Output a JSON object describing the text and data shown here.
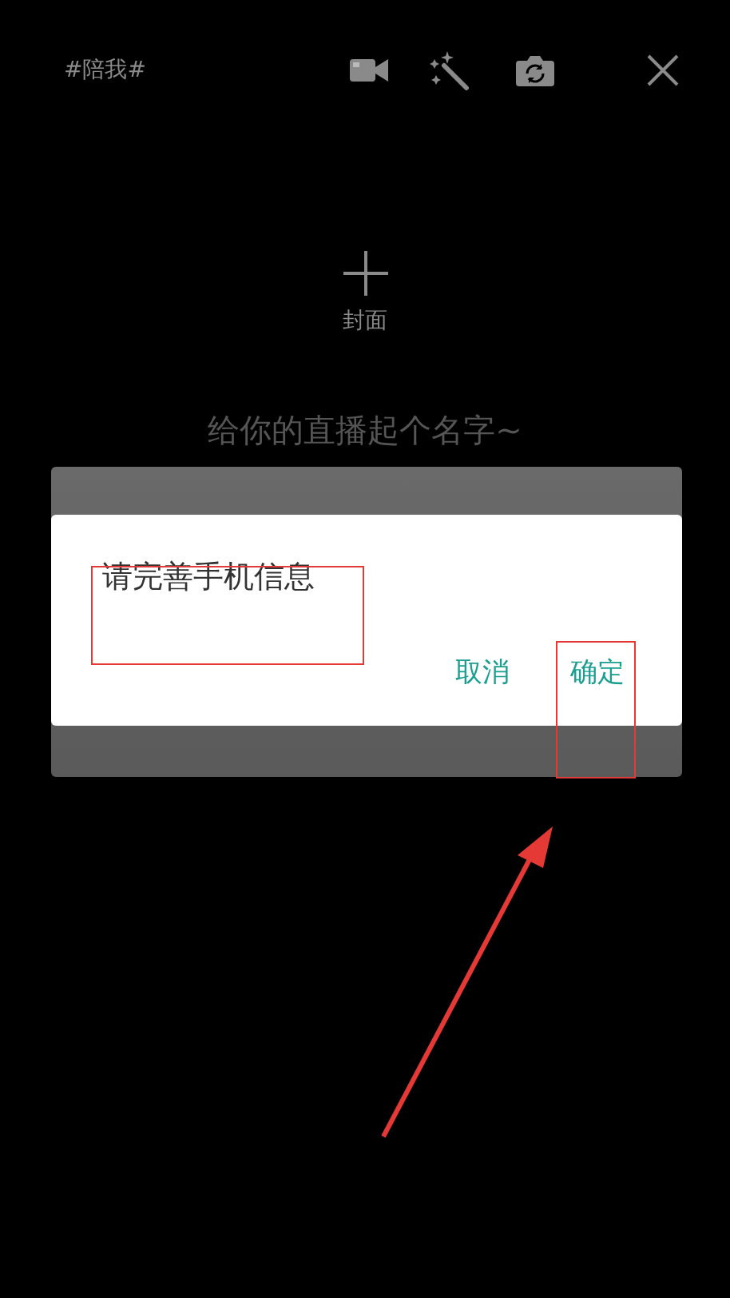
{
  "top_bar": {
    "topic": "#陪我#"
  },
  "cover": {
    "label": "封面"
  },
  "title_field": {
    "placeholder": "给你的直播起个名字~"
  },
  "dialog": {
    "message": "请完善手机信息",
    "buttons": [
      "取消",
      "确定"
    ]
  }
}
